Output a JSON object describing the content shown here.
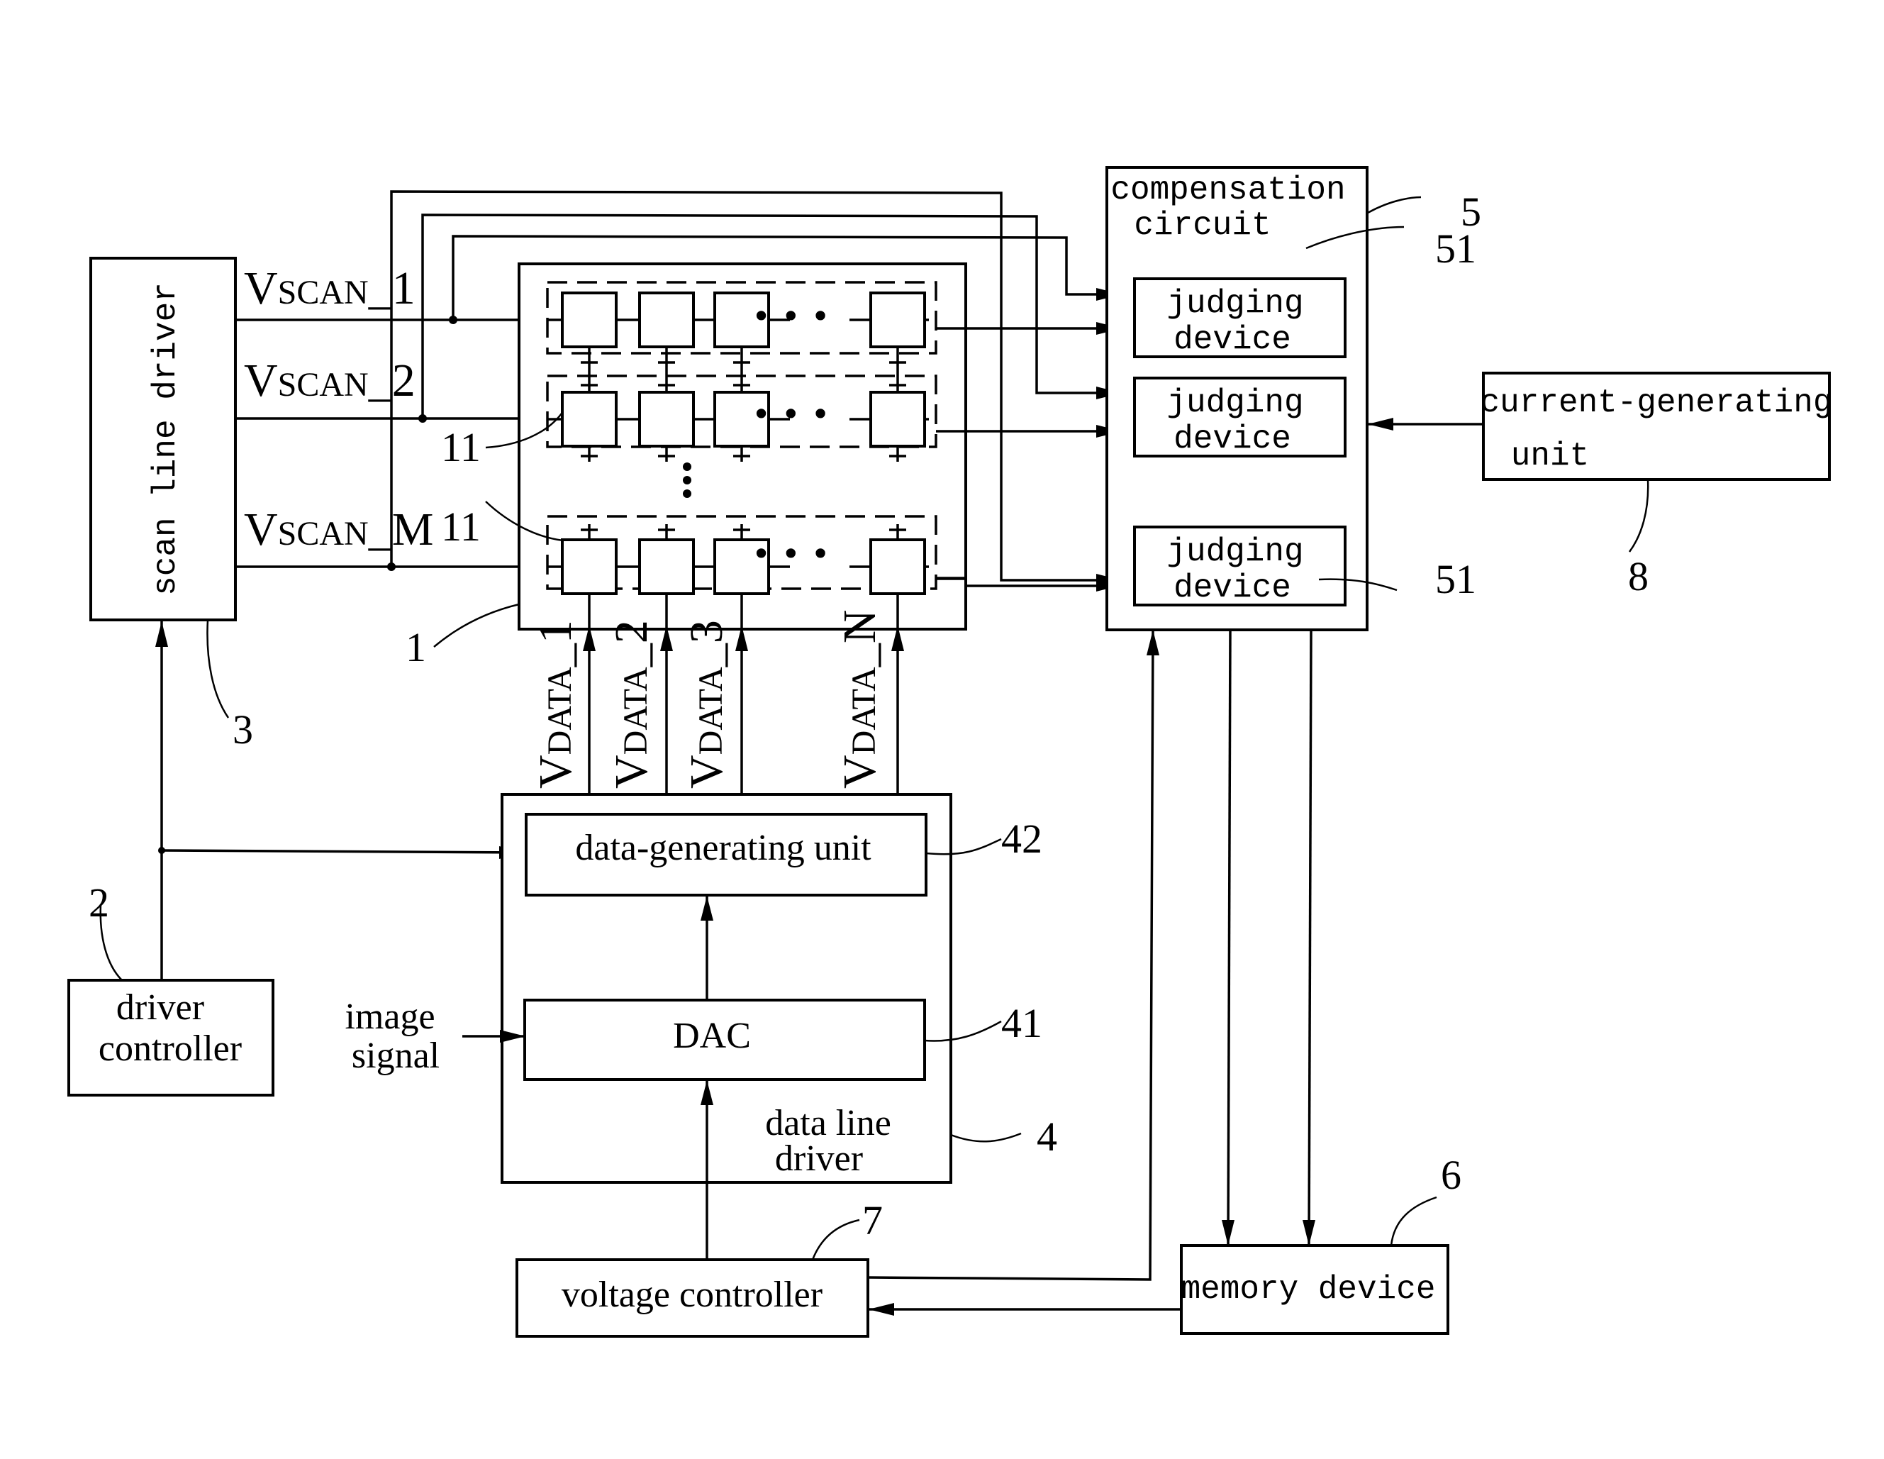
{
  "blocks": {
    "scan_line_driver": {
      "label": "scan line driver",
      "ref": "3"
    },
    "driver_controller": {
      "line1": "driver",
      "line2": "controller",
      "ref": "2"
    },
    "pixel_array": {
      "ref": "1",
      "pixel_ref": "11"
    },
    "compensation_circuit": {
      "line1": "compensation",
      "line2": "circuit",
      "ref": "5"
    },
    "judging_devices": [
      {
        "line1": "judging",
        "line2": "device",
        "ref": "51"
      },
      {
        "line1": "judging",
        "line2": "device",
        "ref": ""
      },
      {
        "line1": "judging",
        "line2": "device",
        "ref": "51"
      }
    ],
    "current_generating_unit": {
      "line1": "current-generating",
      "line2": "unit",
      "ref": "8"
    },
    "data_line_driver": {
      "line1": "data line",
      "line2": "driver",
      "ref": "4"
    },
    "data_generating_unit": {
      "label": "data-generating unit",
      "ref": "42"
    },
    "dac": {
      "label": "DAC",
      "ref": "41"
    },
    "voltage_controller": {
      "label": "voltage controller",
      "ref": "7"
    },
    "memory_device": {
      "label": "memory device",
      "ref": "6"
    }
  },
  "inputs": {
    "image_signal": {
      "line1": "image",
      "line2": "signal"
    }
  },
  "scan_signals": [
    {
      "main": "V",
      "sub": "SCAN",
      "suffix": "_1"
    },
    {
      "main": "V",
      "sub": "SCAN",
      "suffix": "_2"
    },
    {
      "main": "V",
      "sub": "SCAN",
      "suffix": "_M"
    }
  ],
  "data_signals": [
    {
      "main": "V",
      "sub": "DATA",
      "suffix": "_1"
    },
    {
      "main": "V",
      "sub": "DATA",
      "suffix": "_2"
    },
    {
      "main": "V",
      "sub": "DATA",
      "suffix": "_3"
    },
    {
      "main": "V",
      "sub": "DATA",
      "suffix": "_N"
    }
  ],
  "ellipsis": {
    "horizontal": "• • •",
    "vertical": "•"
  }
}
